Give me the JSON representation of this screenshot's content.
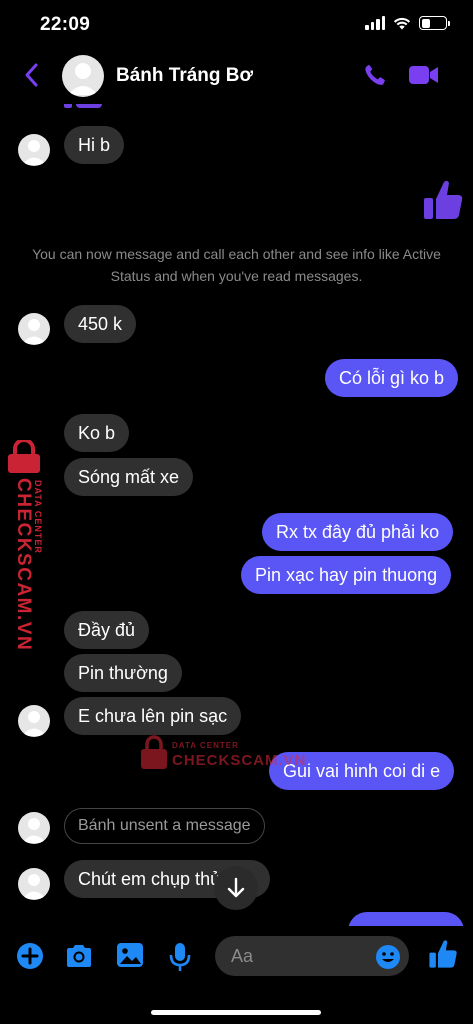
{
  "status_bar": {
    "time": "22:09",
    "battery_level": 0.35
  },
  "header": {
    "contact_name": "Bánh Tráng Bơ",
    "back_icon": "chevron-left-icon",
    "call_icon": "phone-icon",
    "video_icon": "video-camera-icon"
  },
  "colors": {
    "accent": "#7b3ff2",
    "outgoing_bubble": "#5a55f5",
    "incoming_bubble": "#303030",
    "watermark": "#e0283a"
  },
  "notice": "You can now message and call each other and see info like Active Status and when you've read messages.",
  "messages": {
    "m1": "Hi b",
    "m2": "450 k",
    "m3": "Có lỗi gì ko b",
    "m4": "Ko b",
    "m5": "Sóng mất xe",
    "m6": "Rx tx đây đủ phải ko",
    "m7": "Pin xạc hay pin thuong",
    "m8": "Đầy đủ",
    "m9": "Pin thường",
    "m10": "E chưa lên pin sạc",
    "m11": "Gui vai hinh coi di e",
    "m12": "Bánh unsent a message",
    "m13": "Chút em chụp thử cho"
  },
  "watermark": {
    "brand": "CHECKSCAM.VN",
    "sub": "DATA CENTER"
  },
  "composer": {
    "placeholder": "Aa"
  },
  "bottom_icons": [
    "plus-icon",
    "camera-icon",
    "gallery-icon",
    "microphone-icon",
    "emoji-icon",
    "thumbs-up-icon"
  ]
}
